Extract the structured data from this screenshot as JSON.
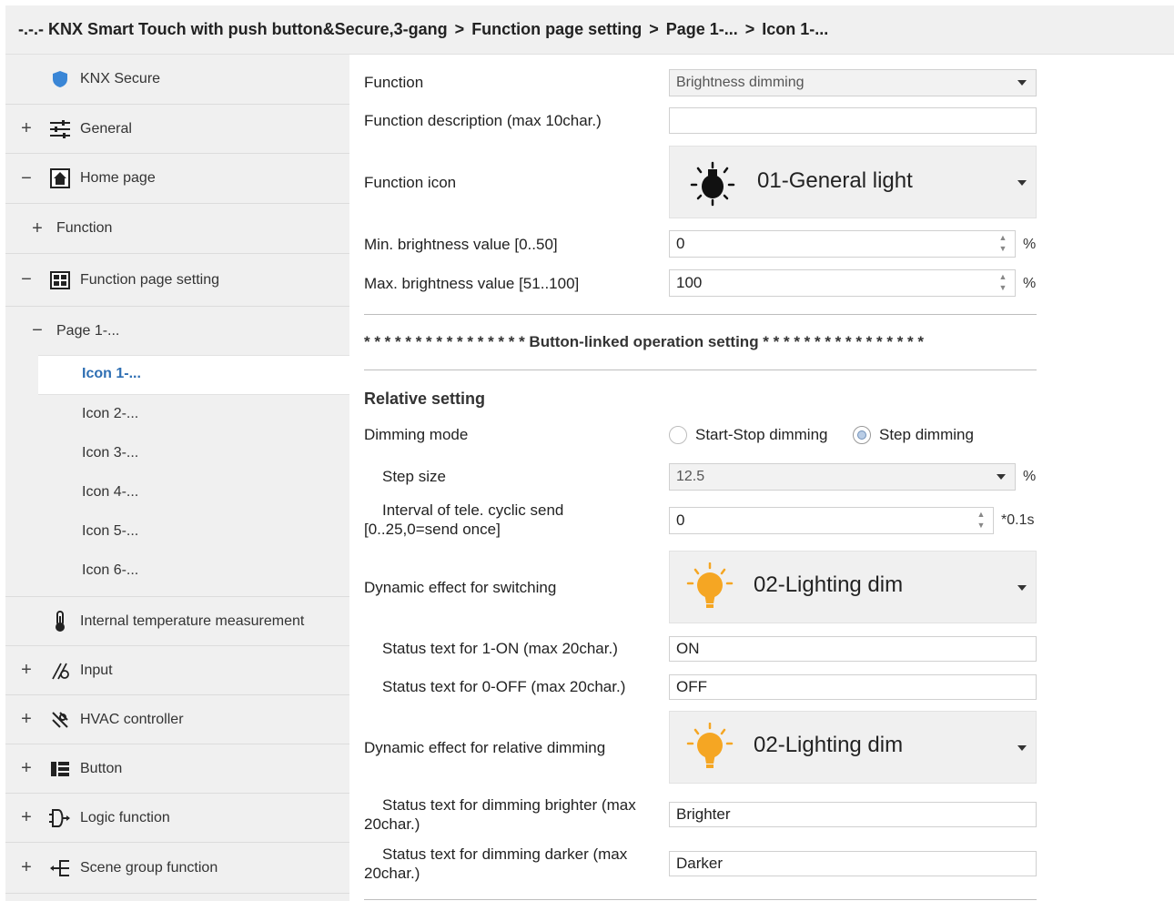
{
  "breadcrumb": {
    "items": [
      "-.-.- KNX Smart Touch with push button&Secure,3-gang",
      "Function page setting",
      "Page 1-...",
      "Icon 1-..."
    ],
    "separator": ">"
  },
  "sidebar": {
    "knx_secure": "KNX Secure",
    "general": "General",
    "home_page": "Home page",
    "function": "Function",
    "function_page_setting": "Function page setting",
    "page1": "Page 1-...",
    "icons": [
      "Icon 1-...",
      "Icon 2-...",
      "Icon 3-...",
      "Icon 4-...",
      "Icon 5-...",
      "Icon 6-..."
    ],
    "internal_temp": "Internal temperature measurement",
    "input": "Input",
    "hvac": "HVAC controller",
    "button": "Button",
    "logic": "Logic function",
    "scene": "Scene group function",
    "plus": "+",
    "minus": "−"
  },
  "main": {
    "function_label": "Function",
    "function_value": "Brightness dimming",
    "desc_label": "Function description (max 10char.)",
    "desc_value": "",
    "icon_label": "Function icon",
    "icon_value": "01-General light",
    "min_label": "Min. brightness value [0..50]",
    "min_value": "0",
    "max_label": "Max. brightness value [51..100]",
    "max_value": "100",
    "percent": "%",
    "section_title": "* * * * * * * * * * * * * * * * Button-linked operation setting * * * * * * * * * * * * * * * *",
    "relative_setting": "Relative setting",
    "dimming_mode_label": "Dimming mode",
    "dimming_options": [
      "Start-Stop dimming",
      "Step dimming"
    ],
    "dimming_selected": "Step dimming",
    "step_size_label": "Step size",
    "step_size_value": "12.5",
    "interval_label_1": "Interval of tele. cyclic send",
    "interval_label_2": "[0..25,0=send once]",
    "interval_value": "0",
    "interval_unit": "*0.1s",
    "dyn_switch_label": "Dynamic effect for switching",
    "dyn_switch_value": "02-Lighting dim",
    "status_on_label": "Status text for 1-ON (max 20char.)",
    "status_on_value": "ON",
    "status_off_label": "Status text for 0-OFF (max 20char.)",
    "status_off_value": "OFF",
    "dyn_rel_label": "Dynamic effect  for relative dimming",
    "dyn_rel_value": "02-Lighting dim",
    "brighter_label_1": "Status text for dimming brighter (max",
    "brighter_label_2": "20char.)",
    "brighter_value": "Brighter",
    "darker_label_1": "Status text for dimming darker (max",
    "darker_label_2": "20char.)",
    "darker_value": "Darker"
  },
  "colors": {
    "accent": "#2f6fb3",
    "sidebar_bg": "#f0f0f0",
    "bulb_orange": "#f5a623"
  }
}
